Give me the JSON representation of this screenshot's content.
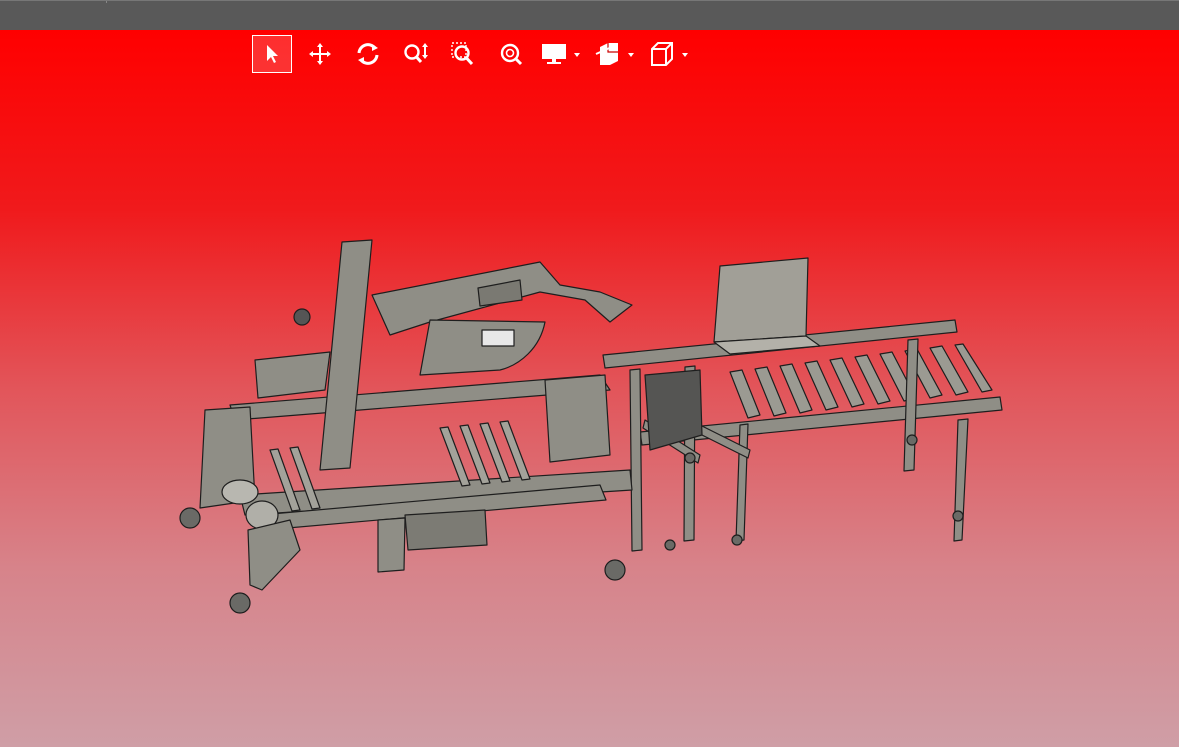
{
  "window": {
    "title": ""
  },
  "toolbar": {
    "tools": [
      {
        "id": "select",
        "icon": "select-arrow-icon",
        "active": true
      },
      {
        "id": "pan",
        "icon": "pan-move-icon",
        "active": false
      },
      {
        "id": "rotate",
        "icon": "rotate-icon",
        "active": false
      },
      {
        "id": "zoom",
        "icon": "zoom-updown-icon",
        "active": false
      },
      {
        "id": "zoom-window",
        "icon": "zoom-window-icon",
        "active": false
      },
      {
        "id": "zoom-fit",
        "icon": "zoom-fit-icon",
        "active": false
      }
    ],
    "dropdowns": [
      {
        "id": "display",
        "icon": "monitor-display-icon"
      },
      {
        "id": "section",
        "icon": "section-view-icon"
      },
      {
        "id": "view-orientation",
        "icon": "view-cube-icon"
      }
    ]
  },
  "viewport": {
    "background_top": "#ff0000",
    "background_bottom": "#cf9ea6",
    "model_color": "#8f8e86",
    "edge_color": "#1e1e1e"
  }
}
